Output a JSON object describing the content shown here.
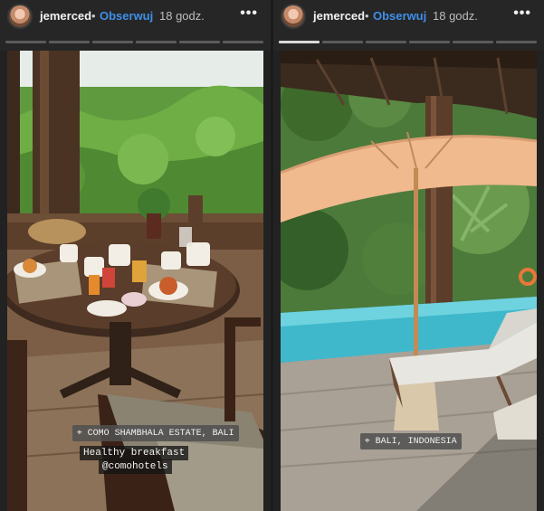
{
  "stories": [
    {
      "username": "jemerced",
      "separator": "•",
      "follow_label": "Obserwuj",
      "time": "18 godz.",
      "more_label": "•••",
      "progress": {
        "segments": 6,
        "viewed": 0
      },
      "location_sticker": "COMO SHAMBHALA ESTATE, BALI",
      "caption_lines": [
        "Healthy breakfast",
        "@comohotels"
      ]
    },
    {
      "username": "jemerced",
      "separator": "•",
      "follow_label": "Obserwuj",
      "time": "18 godz.",
      "more_label": "•••",
      "progress": {
        "segments": 6,
        "viewed": 1
      },
      "location_sticker": "BALI, INDONESIA",
      "caption_lines": []
    }
  ],
  "colors": {
    "background": "#1b1b1b",
    "header": "#262626",
    "follow": "#3f8fe8"
  }
}
